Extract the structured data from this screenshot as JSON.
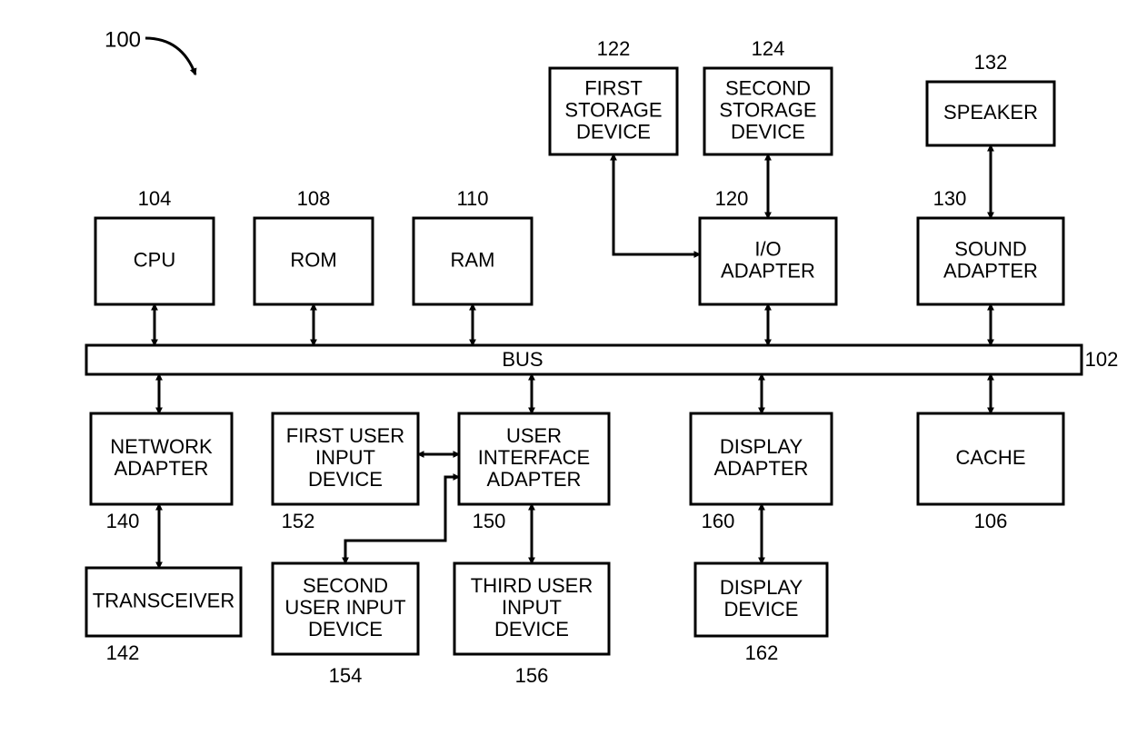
{
  "diagram_ref": "100",
  "bus": {
    "label": "BUS",
    "ref": "102"
  },
  "blocks": {
    "cpu": {
      "label": "CPU",
      "ref": "104",
      "lines": [
        "CPU"
      ]
    },
    "rom": {
      "label": "ROM",
      "ref": "108",
      "lines": [
        "ROM"
      ]
    },
    "ram": {
      "label": "RAM",
      "ref": "110",
      "lines": [
        "RAM"
      ]
    },
    "io": {
      "label": "I/O ADAPTER",
      "ref": "120",
      "lines": [
        "I/O",
        "ADAPTER"
      ]
    },
    "stor1": {
      "label": "FIRST STORAGE DEVICE",
      "ref": "122",
      "lines": [
        "FIRST",
        "STORAGE",
        "DEVICE"
      ]
    },
    "stor2": {
      "label": "SECOND STORAGE DEVICE",
      "ref": "124",
      "lines": [
        "SECOND",
        "STORAGE",
        "DEVICE"
      ]
    },
    "snd": {
      "label": "SOUND ADAPTER",
      "ref": "130",
      "lines": [
        "SOUND",
        "ADAPTER"
      ]
    },
    "spk": {
      "label": "SPEAKER",
      "ref": "132",
      "lines": [
        "SPEAKER"
      ]
    },
    "net": {
      "label": "NETWORK ADAPTER",
      "ref": "140",
      "lines": [
        "NETWORK",
        "ADAPTER"
      ]
    },
    "txr": {
      "label": "TRANSCEIVER",
      "ref": "142",
      "lines": [
        "TRANSCEIVER"
      ]
    },
    "uia": {
      "label": "USER INTERFACE ADAPTER",
      "ref": "150",
      "lines": [
        "USER",
        "INTERFACE",
        "ADAPTER"
      ]
    },
    "uid1": {
      "label": "FIRST USER INPUT DEVICE",
      "ref": "152",
      "lines": [
        "FIRST USER",
        "INPUT",
        "DEVICE"
      ]
    },
    "uid2": {
      "label": "SECOND USER INPUT DEVICE",
      "ref": "154",
      "lines": [
        "SECOND",
        "USER INPUT",
        "DEVICE"
      ]
    },
    "uid3": {
      "label": "THIRD USER INPUT DEVICE",
      "ref": "156",
      "lines": [
        "THIRD USER",
        "INPUT",
        "DEVICE"
      ]
    },
    "dispa": {
      "label": "DISPLAY ADAPTER",
      "ref": "160",
      "lines": [
        "DISPLAY",
        "ADAPTER"
      ]
    },
    "dispd": {
      "label": "DISPLAY DEVICE",
      "ref": "162",
      "lines": [
        "DISPLAY",
        "DEVICE"
      ]
    },
    "cache": {
      "label": "CACHE",
      "ref": "106",
      "lines": [
        "CACHE"
      ]
    }
  }
}
